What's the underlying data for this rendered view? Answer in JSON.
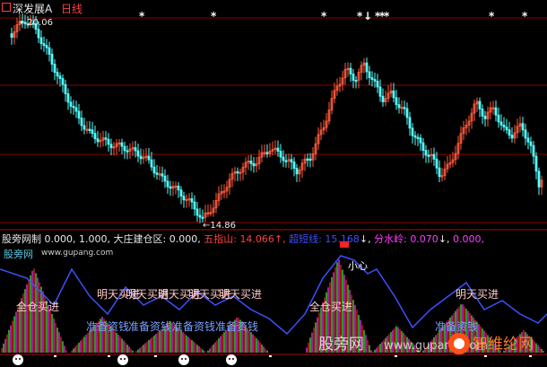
{
  "header": {
    "symbol": "深发展A",
    "period": "日线"
  },
  "price_panel": {
    "high_label": "←20.06",
    "low_label": "←14.86"
  },
  "indicator": {
    "name": "股旁网制",
    "v1": "0.000,",
    "v2": "1.000,",
    "label_a": "大庄建仓区:",
    "value_a": "0.000,",
    "label_b": "五指山:",
    "value_b": "14.066",
    "arrow_b": "↑,",
    "label_c": "超短线:",
    "value_c": "15.168",
    "arrow_c": "↓,",
    "label_d": "分水岭:",
    "value_d": "0.070",
    "arrow_d": "↓,",
    "value_e": "0.000,"
  },
  "lower_panel": {
    "site_name": "股旁网",
    "site_url": "www.gupang.com",
    "buy_full": "全仓买进",
    "buy_tomorrow": "明天买进",
    "prepare_money": "准备资钱",
    "careful": "小心",
    "watermark_left": "股旁网",
    "watermark_right": "www.gupang.com",
    "logo_text": "智维纶网"
  },
  "colors": {
    "background": "#000000",
    "up_candle": "#ff5a3c",
    "down_candle": "#54ffff",
    "grid": "#8b0000",
    "blue_line": "#3c50ff",
    "magenta": "#ff3cff",
    "label_color": "#ffc8c8"
  }
}
